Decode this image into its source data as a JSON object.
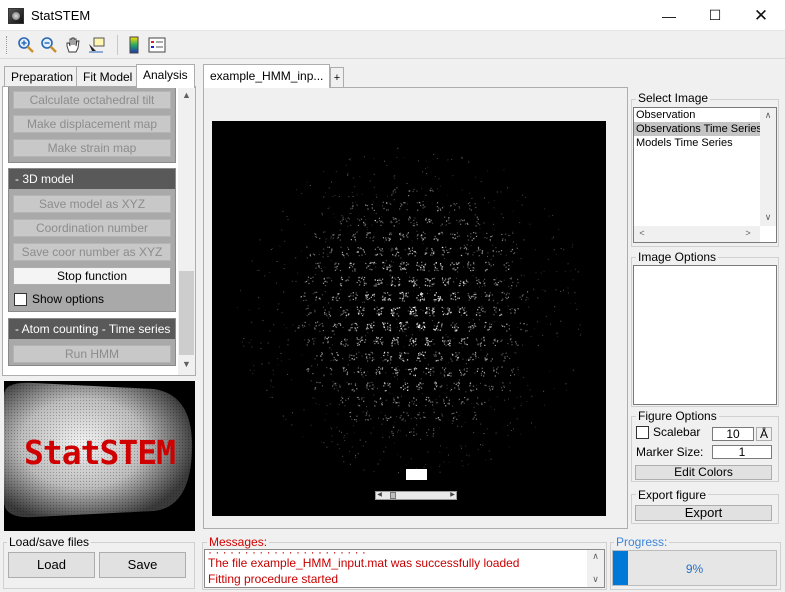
{
  "window": {
    "title": "StatSTEM",
    "min": "—",
    "max": "☐",
    "close": "✕"
  },
  "toolbar": {
    "tools": [
      "zoom-in-icon",
      "zoom-out-icon",
      "pan-icon",
      "data-cursor-icon",
      "colorbar-icon",
      "legend-icon"
    ]
  },
  "left_tabs": [
    "Preparation",
    "Fit Model",
    "Analysis"
  ],
  "analysis": {
    "top_buttons": [
      "Calculate octahedral tilt",
      "Make displacement map",
      "Make strain map"
    ],
    "model3d": {
      "header": "- 3D model",
      "buttons": [
        "Save model as XYZ",
        "Coordination number",
        "Save coor number as XYZ"
      ],
      "stop": "Stop function",
      "show_options": "Show options"
    },
    "atom_counting": {
      "header": "- Atom counting - Time series",
      "run": "Run HMM"
    }
  },
  "logo_text": "StatSTEM",
  "load_save": {
    "title": "Load/save files",
    "load": "Load",
    "save": "Save"
  },
  "doc_tab": "example_HMM_inp...",
  "add_tab": "+",
  "select_image": {
    "title": "Select Image",
    "items": [
      "Observation",
      "Observations Time Series",
      "Models Time Series"
    ],
    "selected_index": 1
  },
  "image_options": {
    "title": "Image Options"
  },
  "figure_options": {
    "title": "Figure Options",
    "scalebar_label": "Scalebar",
    "scalebar_checked": false,
    "scalebar_value": "10",
    "scalebar_unit": "Å",
    "marker_label": "Marker Size:",
    "marker_value": "1",
    "edit_colors": "Edit Colors"
  },
  "export": {
    "title": "Export figure",
    "button": "Export"
  },
  "messages": {
    "title": "Messages:",
    "lines": [
      "The file example_HMM_input.mat was successfully loaded",
      "Fitting procedure started"
    ]
  },
  "progress": {
    "title": "Progress:",
    "label": "9%",
    "value": 0.09
  }
}
